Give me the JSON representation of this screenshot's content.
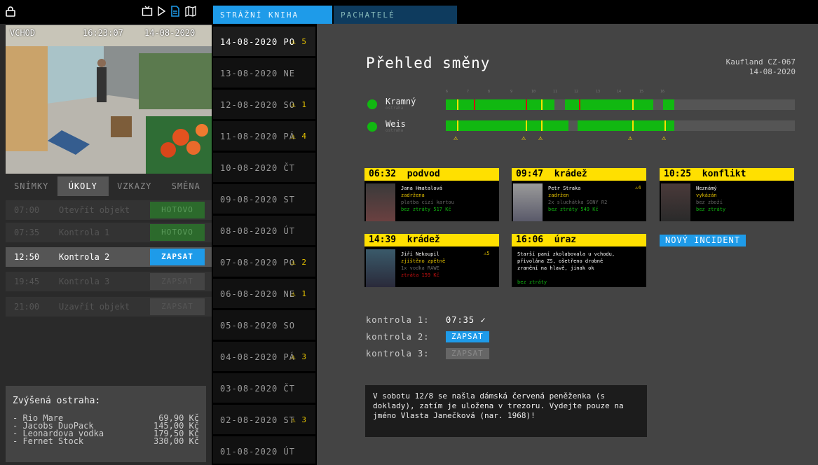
{
  "topbar": {
    "tabs": [
      {
        "label": "STRÁŽNÍ KNIHA"
      },
      {
        "label": "PACHATELÉ"
      }
    ],
    "icons": [
      "lock-icon",
      "tv-icon",
      "play-icon",
      "document-icon",
      "map-icon"
    ]
  },
  "camera": {
    "name": "VCHOD",
    "time": "16:23:07",
    "date": "14-08-2020"
  },
  "subtabs": [
    "SNÍMKY",
    "ÚKOLY",
    "VZKAZY",
    "SMĚNA"
  ],
  "tasks": [
    {
      "time": "07:00",
      "name": "Otevřít objekt",
      "button": "HOTOVO",
      "state": "done"
    },
    {
      "time": "07:35",
      "name": "Kontrola 1",
      "button": "HOTOVO",
      "state": "done"
    },
    {
      "time": "12:50",
      "name": "Kontrola 2",
      "button": "ZAPSAT",
      "state": "active"
    },
    {
      "time": "19:45",
      "name": "Kontrola 3",
      "button": "ZAPSAT",
      "state": "pending"
    },
    {
      "time": "21:00",
      "name": "Uzavřít objekt",
      "button": "ZAPSAT",
      "state": "pending"
    }
  ],
  "watch": {
    "title": "Zvýšená ostraha:",
    "items": [
      {
        "name": "- Rio Mare",
        "price": "69,90 Kč"
      },
      {
        "name": "- Jacobs DuoPack",
        "price": "145,00 Kč"
      },
      {
        "name": "- Leonardova vodka",
        "price": "179,50 Kč"
      },
      {
        "name": "- Fernet Stock",
        "price": "330,00 Kč"
      }
    ]
  },
  "days": [
    {
      "label": "14-08-2020 PO",
      "warn": "⚠ 5"
    },
    {
      "label": "13-08-2020 NE",
      "warn": ""
    },
    {
      "label": "12-08-2020 SO",
      "warn": "⚠ 1"
    },
    {
      "label": "11-08-2020 PÁ",
      "warn": "⚠ 4"
    },
    {
      "label": "10-08-2020 ČT",
      "warn": ""
    },
    {
      "label": "09-08-2020 ST",
      "warn": ""
    },
    {
      "label": "08-08-2020 ÚT",
      "warn": ""
    },
    {
      "label": "07-08-2020 PO",
      "warn": "⚠ 2"
    },
    {
      "label": "06-08-2020 NE",
      "warn": "⚠ 1"
    },
    {
      "label": "05-08-2020 SO",
      "warn": ""
    },
    {
      "label": "04-08-2020 PÁ",
      "warn": "⚠ 3"
    },
    {
      "label": "03-08-2020 ČT",
      "warn": ""
    },
    {
      "label": "02-08-2020 ST",
      "warn": "⚠ 3"
    },
    {
      "label": "01-08-2020 ÚT",
      "warn": ""
    }
  ],
  "main": {
    "title": "Přehled směny",
    "store": "Kaufland CZ-067",
    "date": "14-08-2020",
    "hours": [
      "6",
      "7",
      "8",
      "9",
      "10",
      "11",
      "12",
      "13",
      "14",
      "15",
      "16"
    ],
    "guards": [
      {
        "name": "Kramný",
        "role": "ostraha"
      },
      {
        "name": "Weis",
        "role": "ostraha"
      }
    ],
    "incidents": [
      {
        "time": "06:32",
        "type": "podvod",
        "lines": [
          "Jana Hmatalová",
          "zadržena",
          "platba cizí kartou",
          "bez ztráty 517 Kč"
        ],
        "count": ""
      },
      {
        "time": "09:47",
        "type": "krádež",
        "lines": [
          "Petr Straka",
          "zadržen",
          "2x sluchátka SONY R2",
          "bez ztráty 549 Kč"
        ],
        "count": "⚠4"
      },
      {
        "time": "10:25",
        "type": "konflikt",
        "lines": [
          "Neznámý",
          "vykázán",
          "bez zboží",
          "bez ztráty"
        ],
        "count": ""
      },
      {
        "time": "14:39",
        "type": "krádež",
        "lines": [
          "Jiří Nekoupil",
          "zjištěno zpětně",
          "1x vodka RAWE",
          "ztráta 159 Kč"
        ],
        "count": "⚠5"
      },
      {
        "time": "16:06",
        "type": "úraz",
        "lines": [
          "Starší paní zkolabovala u vchodu,",
          "přivolána ZS, ošetřeno drobné",
          "zranění na hlavě, jinak ok",
          "",
          "bez ztráty"
        ],
        "count": ""
      }
    ],
    "new_incident": "NOVÝ INCIDENT",
    "checks": [
      {
        "label": "kontrola 1:",
        "value": "07:35 ✓"
      },
      {
        "label": "kontrola 2:",
        "value": "ZAPSAT"
      },
      {
        "label": "kontrola 3:",
        "value": "ZAPSAT"
      }
    ],
    "note": "V sobotu 12/8 se našla dámská červená peněženka (s doklady), zatím je uložena v trezoru. Vydejte pouze na jméno Vlasta Janečková (nar. 1968)!"
  },
  "colors": {
    "accent": "#1e9be9",
    "green": "#11b811",
    "warn": "#ffe000",
    "red": "#cc1111"
  }
}
